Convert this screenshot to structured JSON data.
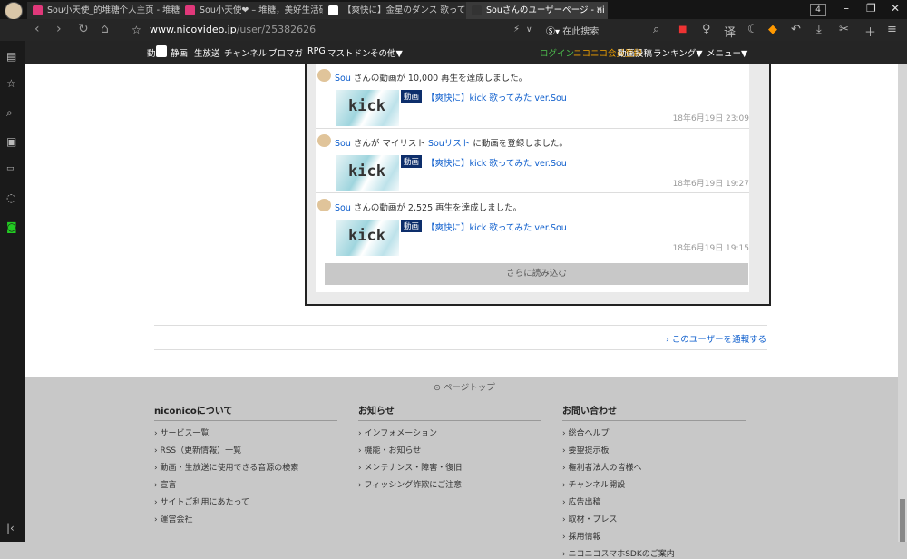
{
  "browser": {
    "tabs": [
      {
        "label": "Sou小天使_的堆糖个人主页 - 堆糖",
        "color": "#e0387a"
      },
      {
        "label": "Sou小天使❤ – 堆糖，美好生活研",
        "color": "#e0387a"
      },
      {
        "label": "【爽快に】金星のダンス 歌ってみ",
        "color": "#ffffff"
      },
      {
        "label": "Souさんのユーザーページ - ni",
        "color": "#333333"
      }
    ],
    "tab_count": "4",
    "url_host": "www.nicovideo.jp",
    "url_path": "/user/25382626",
    "search_placeholder": "在此搜索"
  },
  "nico_nav": {
    "left": [
      "動画",
      "静画",
      "生放送",
      "チャンネル",
      "ブロマガ",
      "RPG",
      "マストドン",
      "その他▼"
    ],
    "login": "ログイン",
    "register": "ニコニコ会員登録",
    "right": [
      "動画投稿",
      "ランキング▼",
      "メニュー▼"
    ]
  },
  "feed": [
    {
      "parts": [
        [
          "Sou",
          true
        ],
        [
          " さんの動画が 10,000 再生を達成しました。",
          false
        ]
      ],
      "badge": "動画",
      "video_title": "【爽快に】kick 歌ってみた ver.Sou",
      "date": "18年6月19日 23:09"
    },
    {
      "parts": [
        [
          "Sou",
          true
        ],
        [
          " さんが マイリスト ",
          false
        ],
        [
          "Souリスト",
          true
        ],
        [
          " に動画を登録しました。",
          false
        ]
      ],
      "badge": "動画",
      "video_title": "【爽快に】kick 歌ってみた ver.Sou",
      "date": "18年6月19日 19:27"
    },
    {
      "parts": [
        [
          "Sou",
          true
        ],
        [
          " さんの動画が 2,525 再生を達成しました。",
          false
        ]
      ],
      "badge": "動画",
      "video_title": "【爽快に】kick 歌ってみた ver.Sou",
      "date": "18年6月19日 19:15"
    }
  ],
  "thumb_text": "kick",
  "load_more": "さらに読み込む",
  "report_link": "› このユーザーを通報する",
  "page_top": "ページトップ",
  "footer": [
    {
      "title": "niconicoについて",
      "items": [
        "› サービス一覧",
        "› RSS（更新情報）一覧",
        "› 動画・生放送に使用できる音源の検索",
        "› 宣言",
        "› サイトご利用にあたって",
        "› 運営会社"
      ]
    },
    {
      "title": "お知らせ",
      "items": [
        "› インフォメーション",
        "› 機能・お知らせ",
        "› メンテナンス・障害・復旧",
        "› フィッシング詐欺にご注意"
      ]
    },
    {
      "title": "お問い合わせ",
      "items": [
        "› 総合ヘルプ",
        "› 要望提示板",
        "› 権利者法人の皆様へ",
        "› チャンネル開設",
        "› 広告出稿",
        "› 取材・プレス",
        "› 採用情報",
        "› ニコニコスマホSDKのご案内"
      ]
    }
  ]
}
